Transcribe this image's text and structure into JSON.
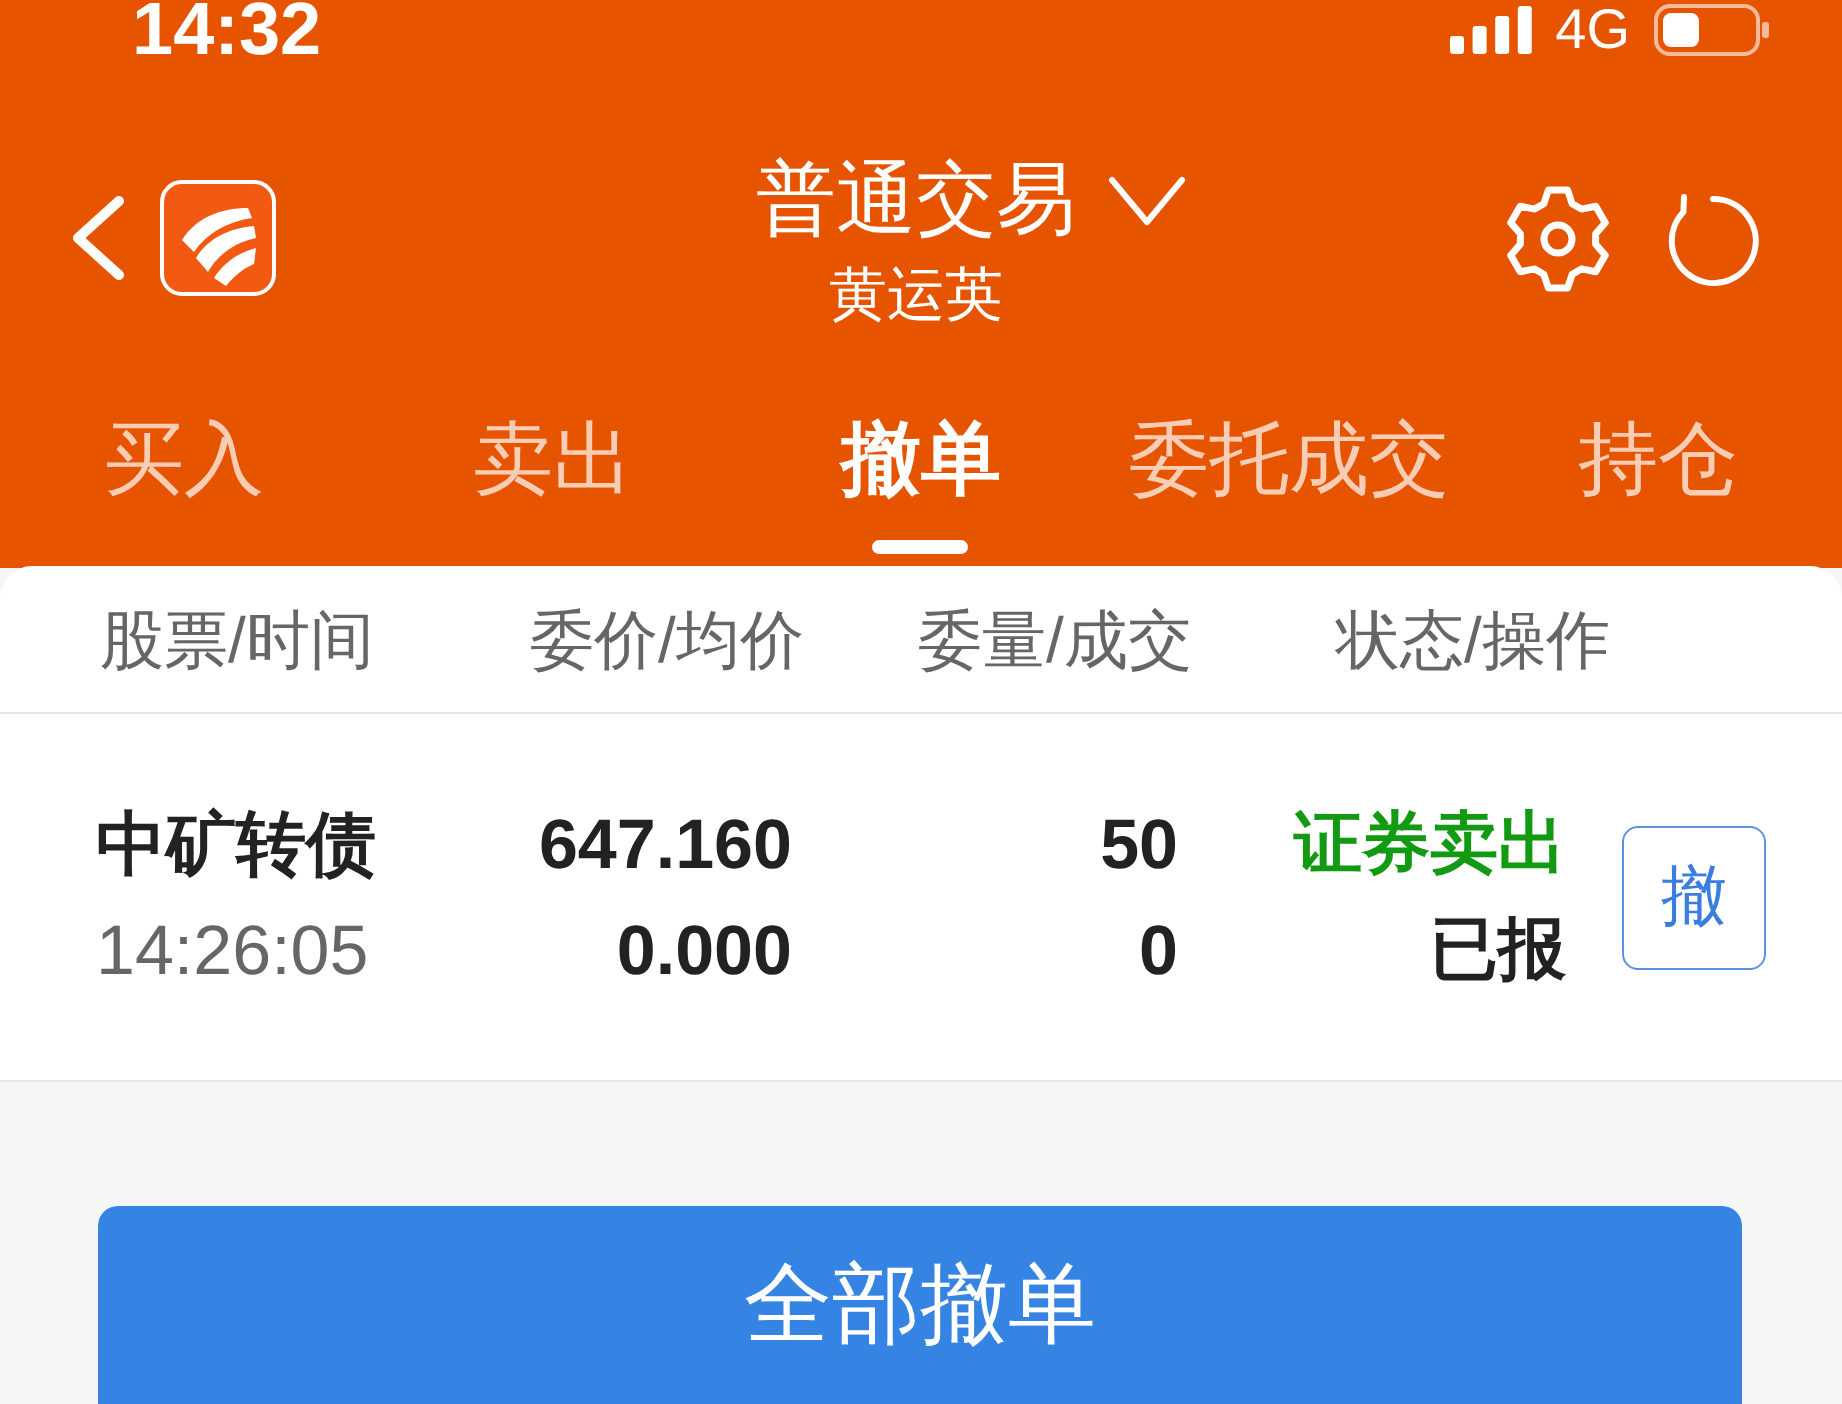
{
  "status_bar": {
    "time": "14:32",
    "network": "4G"
  },
  "header": {
    "title": "普通交易",
    "account": "黄运英"
  },
  "tabs": [
    {
      "label": "买入",
      "selected": false
    },
    {
      "label": "卖出",
      "selected": false
    },
    {
      "label": "撤单",
      "selected": true
    },
    {
      "label": "委托成交",
      "selected": false
    },
    {
      "label": "持仓",
      "selected": false
    }
  ],
  "table": {
    "columns": [
      "股票/时间",
      "委价/均价",
      "委量/成交",
      "状态/操作"
    ],
    "rows": [
      {
        "stock": "中矿转债",
        "time": "14:26:05",
        "order_price": "647.160",
        "average_price": "0.000",
        "order_quantity": "50",
        "filled_quantity": "0",
        "side": "证券卖出",
        "color": "#139a13",
        "status": "已报",
        "action": "撤"
      }
    ]
  },
  "cancel_all_button": {
    "label": "全部撤单"
  }
}
